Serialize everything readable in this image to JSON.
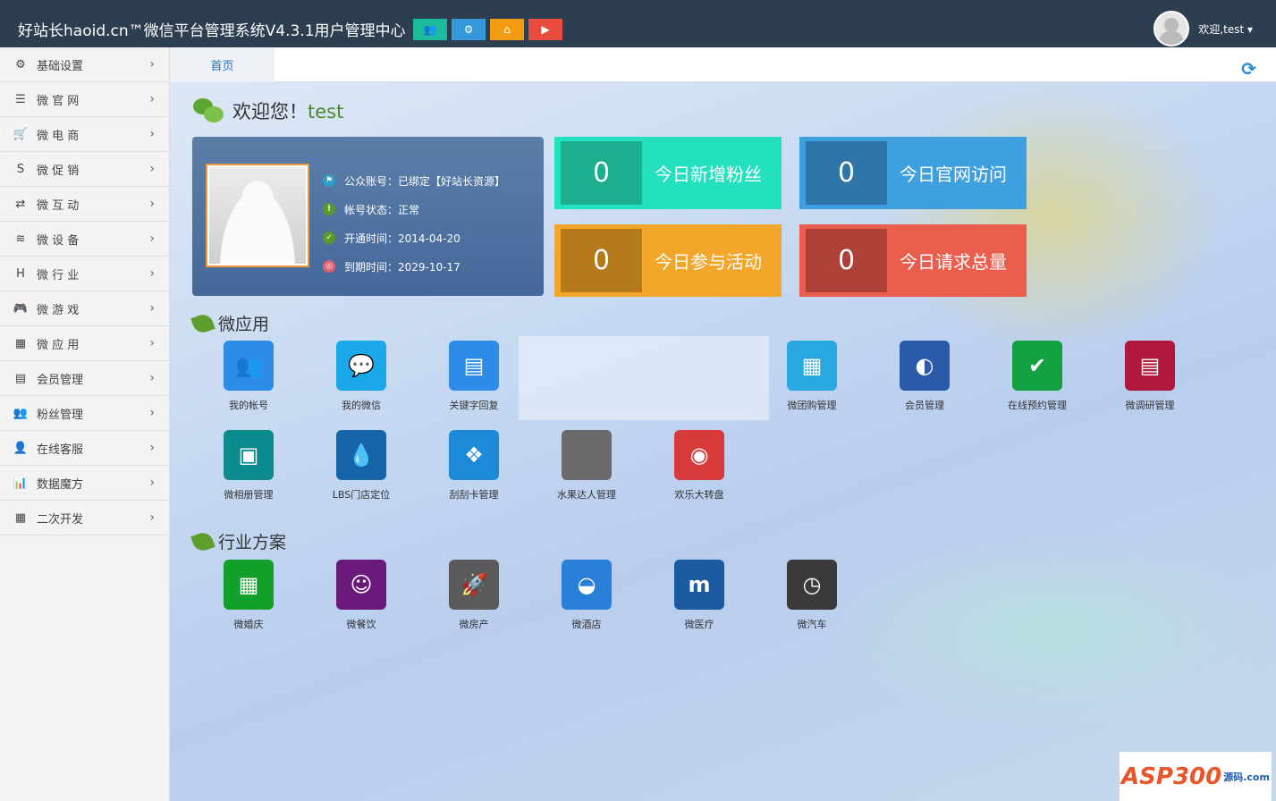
{
  "header": {
    "title": "好站长haoid.cn™微信平台管理系统V4.3.1用户管理中心",
    "buttons": [
      {
        "icon": "users-icon",
        "color": "#1abc9c",
        "glyph": "👥"
      },
      {
        "icon": "gear-icon",
        "color": "#3498db",
        "glyph": "⚙"
      },
      {
        "icon": "home-icon",
        "color": "#f39c12",
        "glyph": "⌂"
      },
      {
        "icon": "play-icon",
        "color": "#e74c3c",
        "glyph": "▶"
      }
    ],
    "user": "欢迎,test ▾"
  },
  "sidebar": {
    "items": [
      {
        "label": "基础设置",
        "glyph": "⚙"
      },
      {
        "label": "微 官 网",
        "glyph": "☰"
      },
      {
        "label": "微 电 商",
        "glyph": "🛒"
      },
      {
        "label": "微 促 销",
        "glyph": "S"
      },
      {
        "label": "微 互 动",
        "glyph": "⇄"
      },
      {
        "label": "微 设 备",
        "glyph": "≋"
      },
      {
        "label": "微 行 业",
        "glyph": "H"
      },
      {
        "label": "微 游 戏",
        "glyph": "🎮"
      },
      {
        "label": "微 应 用",
        "glyph": "▦"
      },
      {
        "label": "会员管理",
        "glyph": "▤"
      },
      {
        "label": "粉丝管理",
        "glyph": "👥"
      },
      {
        "label": "在线客服",
        "glyph": "👤"
      },
      {
        "label": "数据魔方",
        "glyph": "📊"
      },
      {
        "label": "二次开发",
        "glyph": "▦"
      }
    ]
  },
  "tabs": {
    "home": "首页"
  },
  "welcome": {
    "text": "欢迎您！",
    "name": "test"
  },
  "profile": {
    "rows": [
      {
        "label": "公众账号：已绑定【好站长资源】",
        "color": "#2fa0c8",
        "glyph": "⚑"
      },
      {
        "label": "帐号状态：正常",
        "color": "#5a9a2a",
        "glyph": "!"
      },
      {
        "label": "开通时间：2014-04-20",
        "color": "#5a9a2a",
        "glyph": "✓"
      },
      {
        "label": "到期时间：2029-10-17",
        "color": "#e06070",
        "glyph": "◎"
      }
    ]
  },
  "stats": [
    {
      "value": "0",
      "label": "今日新增粉丝",
      "bg": "#23e0bf",
      "dark": "#1cae8f"
    },
    {
      "value": "0",
      "label": "今日官网访问",
      "bg": "#3fa0e0",
      "dark": "#2e76aa"
    },
    {
      "value": "0",
      "label": "今日参与活动",
      "bg": "#f3a72a",
      "dark": "#b57a1c"
    },
    {
      "value": "0",
      "label": "今日请求总量",
      "bg": "#eb5e4e",
      "dark": "#ad4037"
    }
  ],
  "apps_title": "微应用",
  "apps": [
    {
      "label": "我的帐号",
      "color": "#2d8ce8",
      "glyph": "👥"
    },
    {
      "label": "我的微信",
      "color": "#1ba8ea",
      "glyph": "💬"
    },
    {
      "label": "关键字回复",
      "color": "#2d8ce8",
      "glyph": "▤"
    },
    {
      "label": "微团购管理",
      "color": "#2aa8e0",
      "glyph": "▦"
    },
    {
      "label": "会员管理",
      "color": "#2a5aa8",
      "glyph": "◐"
    },
    {
      "label": "在线预约管理",
      "color": "#12a040",
      "glyph": "✔"
    },
    {
      "label": "微调研管理",
      "color": "#b0183e",
      "glyph": "▤"
    },
    {
      "label": "微相册管理",
      "color": "#0d8a8e",
      "glyph": "▣"
    },
    {
      "label": "LBS门店定位",
      "color": "#1565a8",
      "glyph": "💧"
    },
    {
      "label": "刮刮卡管理",
      "color": "#1c8ad8",
      "glyph": "❖"
    },
    {
      "label": "水果达人管理",
      "color": "#6a6a6a",
      "glyph": ""
    },
    {
      "label": "欢乐大转盘",
      "color": "#d83a3a",
      "glyph": "◉"
    }
  ],
  "industry_title": "行业方案",
  "industry": [
    {
      "label": "微婚庆",
      "color": "#12a02a",
      "glyph": "▦"
    },
    {
      "label": "微餐饮",
      "color": "#6a1a7a",
      "glyph": "☺"
    },
    {
      "label": "微房产",
      "color": "#5a5a5a",
      "glyph": "🚀"
    },
    {
      "label": "微酒店",
      "color": "#2a80d8",
      "glyph": "◒"
    },
    {
      "label": "微医疗",
      "color": "#1a5aa0",
      "glyph": "m"
    },
    {
      "label": "微汽车",
      "color": "#3a3a3a",
      "glyph": "◷"
    }
  ],
  "watermark": {
    "text": "ASP300",
    "suffix": "源码.com"
  }
}
